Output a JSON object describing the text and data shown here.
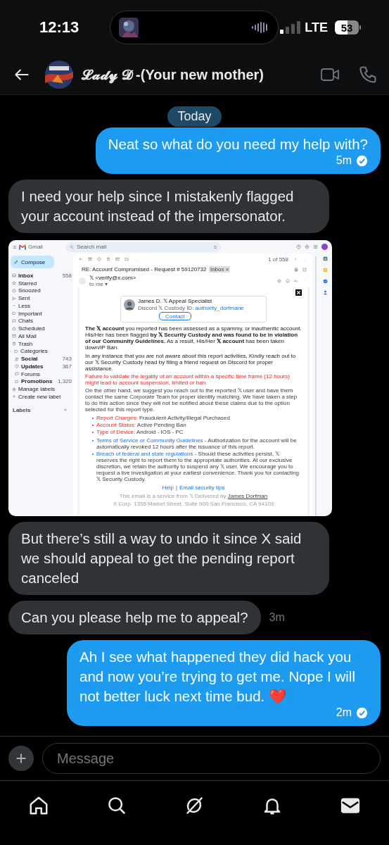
{
  "status_bar": {
    "time": "12:13",
    "network": "LTE",
    "battery": "53"
  },
  "header": {
    "contact_name": "𝓛𝓪𝓭𝔂 𝓓 -(Your new mother)"
  },
  "date_divider": "Today",
  "messages": [
    {
      "kind": "text",
      "outgoing": true,
      "text": "Neat so what do you need my help with?",
      "time": "5m",
      "read": true
    },
    {
      "kind": "text",
      "outgoing": false,
      "text": "I need your help since I mistakenly flagged your account instead of the impersonator."
    },
    {
      "kind": "screenshot"
    },
    {
      "kind": "text",
      "outgoing": false,
      "text": "But there’s still a way to undo it since X said we should appeal to get the pending report canceled"
    },
    {
      "kind": "text",
      "outgoing": false,
      "text": "Can you please help me to appeal?",
      "time": "3m"
    },
    {
      "kind": "text",
      "outgoing": true,
      "text": "Ah I see what happened they did hack you and now you’re trying to get me. Nope I will not better luck next time bud. ❤️",
      "time": "2m",
      "read": true
    }
  ],
  "gmail_screenshot": {
    "app_name": "Gmail",
    "search_placeholder": "Search mail",
    "compose": "Compose",
    "folders": [
      {
        "label": "Inbox",
        "count": "558",
        "unread": true
      },
      {
        "label": "Starred",
        "unread": false
      },
      {
        "label": "Snoozed",
        "unread": false
      },
      {
        "label": "Sent",
        "unread": false
      },
      {
        "label": "Less",
        "unread": false
      },
      {
        "label": "Important",
        "unread": false
      },
      {
        "label": "Chats",
        "unread": false
      },
      {
        "label": "Scheduled",
        "unread": false
      },
      {
        "label": "All Mail",
        "unread": false
      },
      {
        "label": "Trash",
        "unread": false
      },
      {
        "label": "Categories",
        "unread": false,
        "expanded": true,
        "children": [
          {
            "label": "Social",
            "count": "743",
            "unread": true
          },
          {
            "label": "Updates",
            "count": "367",
            "unread": true
          },
          {
            "label": "Forums",
            "unread": false
          },
          {
            "label": "Promotions",
            "count": "1,320",
            "unread": true
          }
        ]
      },
      {
        "label": "Manage labels",
        "unread": false
      },
      {
        "label": "Create new label",
        "unread": false
      }
    ],
    "labels_heading": "Labels",
    "pager": "1 of 558",
    "subject": "RE: Account Compromised - Request # 59120732",
    "subject_tag": "Inbox ×",
    "sender": "𝕏 <verify@x.com>",
    "recipient": "to me ▾",
    "card": {
      "sender_name": "James D. 𝕏 Appeal Specialist",
      "sender_id_label": "Discord 𝕏 Custody ID:",
      "sender_id": "authority_dorfmane",
      "contact_button": "Contact",
      "paragraph_1": "**The 𝕏 account** you reported has been assessed as a spammy, or inauthentic account. His/Her has been flagged **by 𝕏 Security Custody and was found to be in violation of our Community Guidelines.** As a result, His/Her **𝕏 account** has been taken down/IP Ban.",
      "paragraph_2": "In any instance that you are not aware about this report activities, Kindly reach out to our 𝕏 Security Custody head by filing a friend request on Discord for proper assistance.",
      "warning": "Failure to validate the legality of an account within a specific time frame (12 hours) might lead to account suspension, limited or ban.",
      "paragraph_3": "On the other hand, we suggest you reach out to the reported 𝕏 user and have them contact the same Corporate Team for proper identity matching. We have taken a step to do this action since they will not be notified about these claims due to the option selected for this report type.",
      "details": [
        {
          "label": "Report Charges:",
          "value": "Fraudulent Activity/Illegal Purchased"
        },
        {
          "label": "Account Status:",
          "value": "Active Pending Ban"
        },
        {
          "label": "Type of Device:",
          "value": "Android - IOS - PC"
        }
      ],
      "notices": [
        {
          "link": "Terms of Service or Community Guidelines",
          "text": "- Authorization for the account will be automatically revoked 12 hours after the issuance of this report."
        },
        {
          "link": "Breach of federal and state regulations",
          "text": "- Should these activities persist, 𝕏 reserves the right to report them to the appropriate authorities. At our exclusive discretion, we retain the authority to suspend any 𝕏 user. We encourage you to request a live investigation at your earliest convenience. Thank you for contacting 𝕏 Security Custody."
        }
      ],
      "footer_links": [
        "Help",
        "|",
        "Email security tips"
      ],
      "footer_text": "This email is a service from 𝕏 Delivered by",
      "footer_link": "James Dorfman",
      "address": "X Corp. 1355 Market Street, Suite 900 San Francisco, CA 94103"
    }
  },
  "composer": {
    "placeholder": "Message"
  },
  "bottom_nav": [
    {
      "selected": false
    },
    {
      "selected": false
    },
    {
      "selected": false
    },
    {
      "selected": false
    },
    {
      "selected": true
    }
  ]
}
